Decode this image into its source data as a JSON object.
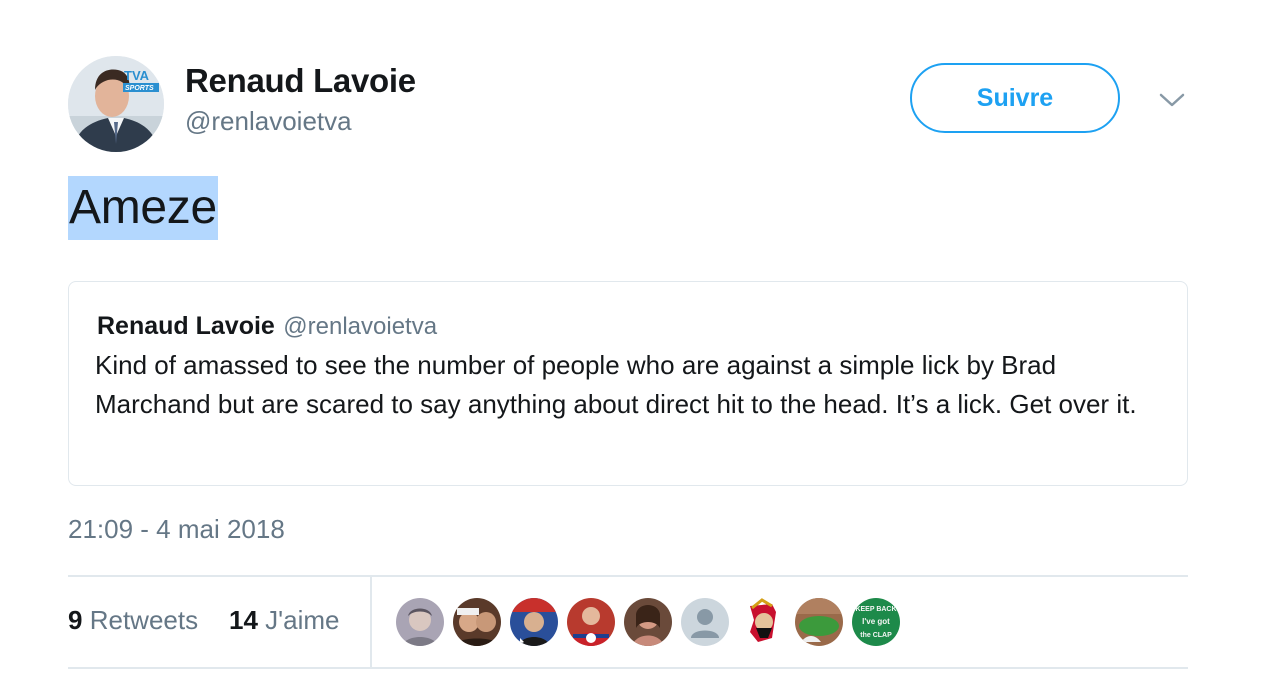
{
  "author": {
    "name": "Renaud Lavoie",
    "handle": "@renlavoietva",
    "avatar_logo_top": "TVA",
    "avatar_logo_bottom": "SPORTS"
  },
  "follow_button": {
    "label": "Suivre"
  },
  "menu": {
    "icon": "chevron-down-icon"
  },
  "tweet": {
    "text": "Ameze",
    "selection_color": "#b3d7fe"
  },
  "quoted_tweet": {
    "name": "Renaud Lavoie",
    "handle": "@renlavoietva",
    "text": "Kind of amassed to see the number of people who are against a simple lick by Brad Marchand but are scared to say anything about direct hit to the head. It’s a lick. Get over it."
  },
  "timestamp": "21:09 - 4 mai 2018",
  "stats": {
    "retweets_count": "9",
    "retweets_label": "Retweets",
    "likes_count": "14",
    "likes_label": "J'aime"
  },
  "likers": [
    {
      "icon": "user-avatar-1"
    },
    {
      "icon": "user-avatar-2"
    },
    {
      "icon": "user-avatar-3"
    },
    {
      "icon": "user-avatar-4"
    },
    {
      "icon": "user-avatar-5"
    },
    {
      "icon": "default-avatar-icon"
    },
    {
      "icon": "senators-logo-icon"
    },
    {
      "icon": "stadium-avatar"
    },
    {
      "icon": "keep-back-avatar",
      "text_1": "KEEP BACK",
      "text_2": "I've got",
      "text_3": "the CLAP"
    }
  ],
  "colors": {
    "accent": "#1da1f2",
    "secondary_text": "#657786",
    "border": "#e1e8ed",
    "primary_text": "#14171a"
  }
}
